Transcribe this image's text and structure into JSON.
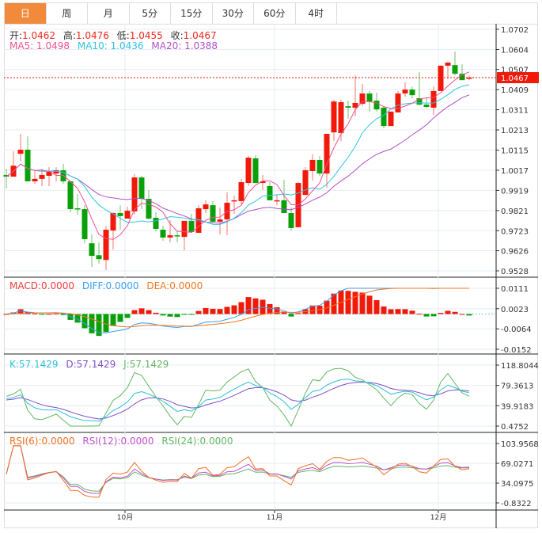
{
  "tabs": [
    "日",
    "周",
    "月",
    "5分",
    "15分",
    "30分",
    "60分",
    "4时"
  ],
  "active_tab": 0,
  "ohlc_legend": {
    "open_label": "开:",
    "open": "1.0462",
    "high_label": "高:",
    "high": "1.0476",
    "low_label": "低:",
    "low": "1.0455",
    "close_label": "收:",
    "close": "1.0467"
  },
  "ma_legend": {
    "ma5": "MA5: 1.0498",
    "ma10": "MA10: 1.0436",
    "ma20": "MA20: 1.0388"
  },
  "macd_legend": {
    "macd": "MACD:0.0000",
    "diff": "DIFF:0.0000",
    "dea": "DEA:0.0000"
  },
  "kdj_legend": {
    "k": "K:57.1429",
    "d": "D:57.1429",
    "j": "J:57.1429"
  },
  "rsi_legend": {
    "rsi6": "RSI(6):0.0000",
    "rsi12": "RSI(12):0.0000",
    "rsi24": "RSI(24):0.0000"
  },
  "current_price": "1.0467",
  "colors": {
    "up": "#f0190a",
    "down": "#0aa00a",
    "ma5": "#f0508c",
    "ma10": "#2ec4e0",
    "ma20": "#b050c8",
    "diff": "#3a9ef0",
    "dea": "#f07820",
    "k": "#2cc0d8",
    "d": "#8050c8",
    "j": "#60b860",
    "rsi6": "#f07020",
    "rsi12": "#c050d0",
    "rsi24": "#60b860",
    "tab_active": "#f28a3c"
  },
  "chart_data": {
    "type": "candlestick",
    "price_axis": {
      "range": [
        0.9528,
        1.0702
      ],
      "ticks": [
        "1.0702",
        "1.0604",
        "1.0507",
        "1.0409",
        "1.0311",
        "1.0213",
        "1.0115",
        "1.0017",
        "0.9919",
        "0.9821",
        "0.9723",
        "0.9626",
        "0.9528"
      ]
    },
    "macd_axis": {
      "range": [
        -0.0152,
        0.0111
      ],
      "ticks": [
        "0.0111",
        "0.0023",
        "-0.0064",
        "-0.0152"
      ]
    },
    "kdj_axis": {
      "range": [
        0.4752,
        118.8044
      ],
      "ticks": [
        "118.8044",
        "79.3613",
        "39.9183",
        "0.4752"
      ]
    },
    "rsi_axis": {
      "range": [
        -0.8322,
        103.9568
      ],
      "ticks": [
        "103.9568",
        "69.0271",
        "34.0975",
        "-0.8322"
      ]
    },
    "months": [
      {
        "label": "10月",
        "index": 17
      },
      {
        "label": "11月",
        "index": 38
      },
      {
        "label": "12月",
        "index": 61
      }
    ],
    "candles": [
      [
        0.9994,
        1.0024,
        0.9928,
        0.9986
      ],
      [
        0.9986,
        1.0109,
        0.9986,
        1.0039
      ],
      [
        1.0097,
        1.0194,
        1.0059,
        1.0117
      ],
      [
        1.0117,
        1.0182,
        0.9963,
        0.9963
      ],
      [
        0.9963,
        1.0017,
        0.9951,
        0.9975
      ],
      [
        0.9975,
        1.0024,
        0.994,
        0.9994
      ],
      [
        0.999,
        1.0032,
        0.994,
        1.0009
      ],
      [
        1.0001,
        1.0032,
        0.9963,
        1.0017
      ],
      [
        1.0017,
        1.0047,
        0.9951,
        0.9963
      ],
      [
        0.9963,
        0.9963,
        0.9813,
        0.9828
      ],
      [
        0.9832,
        0.9901,
        0.9801,
        0.9828
      ],
      [
        0.9828,
        0.9847,
        0.9662,
        0.9682
      ],
      [
        0.9662,
        0.9705,
        0.9547,
        0.9601
      ],
      [
        0.9604,
        0.9666,
        0.9562,
        0.9585
      ],
      [
        0.9581,
        0.9747,
        0.9532,
        0.9728
      ],
      [
        0.9724,
        0.9813,
        0.9631,
        0.9809
      ],
      [
        0.9809,
        0.9847,
        0.9728,
        0.9794
      ],
      [
        0.9782,
        0.984,
        0.9782,
        0.982
      ],
      [
        0.9817,
        0.9998,
        0.9801,
        0.9982
      ],
      [
        0.9982,
        0.999,
        0.9828,
        0.9878
      ],
      [
        0.9878,
        0.9921,
        0.9778,
        0.9782
      ],
      [
        0.9786,
        0.9813,
        0.972,
        0.9732
      ],
      [
        0.9728,
        0.9747,
        0.9674,
        0.969
      ],
      [
        0.969,
        0.9774,
        0.9666,
        0.9701
      ],
      [
        0.9701,
        0.9724,
        0.9666,
        0.9697
      ],
      [
        0.9693,
        0.9771,
        0.9628,
        0.9771
      ],
      [
        0.9771,
        0.9805,
        0.9713,
        0.9717
      ],
      [
        0.9713,
        0.9847,
        0.9713,
        0.9832
      ],
      [
        0.9828,
        0.9871,
        0.9809,
        0.9851
      ],
      [
        0.9847,
        0.9867,
        0.9759,
        0.9767
      ],
      [
        0.9767,
        0.9836,
        0.9705,
        0.9778
      ],
      [
        0.9778,
        0.9909,
        0.9701,
        0.9859
      ],
      [
        0.9867,
        0.9894,
        0.9805,
        0.9871
      ],
      [
        0.9867,
        0.9975,
        0.9851,
        0.9959
      ],
      [
        0.9955,
        1.0086,
        0.994,
        1.0078
      ],
      [
        1.0075,
        1.009,
        0.9955,
        0.9955
      ],
      [
        0.9955,
        0.9994,
        0.9921,
        0.9963
      ],
      [
        0.994,
        0.9959,
        0.9871,
        0.9871
      ],
      [
        0.9867,
        0.9901,
        0.9847,
        0.9871
      ],
      [
        0.9871,
        0.9971,
        0.9809,
        0.9809
      ],
      [
        0.9809,
        0.9836,
        0.9724,
        0.9736
      ],
      [
        0.974,
        0.9959,
        0.974,
        0.9955
      ],
      [
        0.9897,
        1.0032,
        0.9897,
        1.0017
      ],
      [
        1.0013,
        1.0094,
        0.9967,
        1.0067
      ],
      [
        1.0067,
        1.0086,
        0.999,
        1.0001
      ],
      [
        1.0001,
        1.0194,
        0.9932,
        1.0194
      ],
      [
        1.0201,
        1.0359,
        1.0159,
        1.0351
      ],
      [
        1.0198,
        1.0359,
        1.0159,
        1.0348
      ],
      [
        1.0328,
        1.0355,
        1.0267,
        1.0321
      ],
      [
        1.0321,
        1.0478,
        1.0279,
        1.0344
      ],
      [
        1.034,
        1.0436,
        1.0328,
        1.039
      ],
      [
        1.039,
        1.0402,
        1.0302,
        1.0351
      ],
      [
        1.0355,
        1.0394,
        1.0302,
        1.0313
      ],
      [
        1.0321,
        1.0328,
        1.0221,
        1.0232
      ],
      [
        1.0232,
        1.0302,
        1.0232,
        1.0302
      ],
      [
        1.0298,
        1.0402,
        1.0298,
        1.039
      ],
      [
        1.039,
        1.0444,
        1.0374,
        1.0409
      ],
      [
        1.0409,
        1.0424,
        1.0367,
        1.0382
      ],
      [
        1.0367,
        1.0494,
        1.0332,
        1.0336
      ],
      [
        1.0336,
        1.0371,
        1.0321,
        1.0325
      ],
      [
        1.0321,
        1.0424,
        1.0286,
        1.0402
      ],
      [
        1.0402,
        1.0528,
        1.0402,
        1.0525
      ],
      [
        1.0525,
        1.0544,
        1.0459,
        1.054
      ],
      [
        1.0528,
        1.0594,
        1.0478,
        1.0486
      ],
      [
        1.0486,
        1.0532,
        1.0455,
        1.0455
      ],
      [
        1.0462,
        1.0476,
        1.0455,
        1.0467
      ]
    ]
  }
}
